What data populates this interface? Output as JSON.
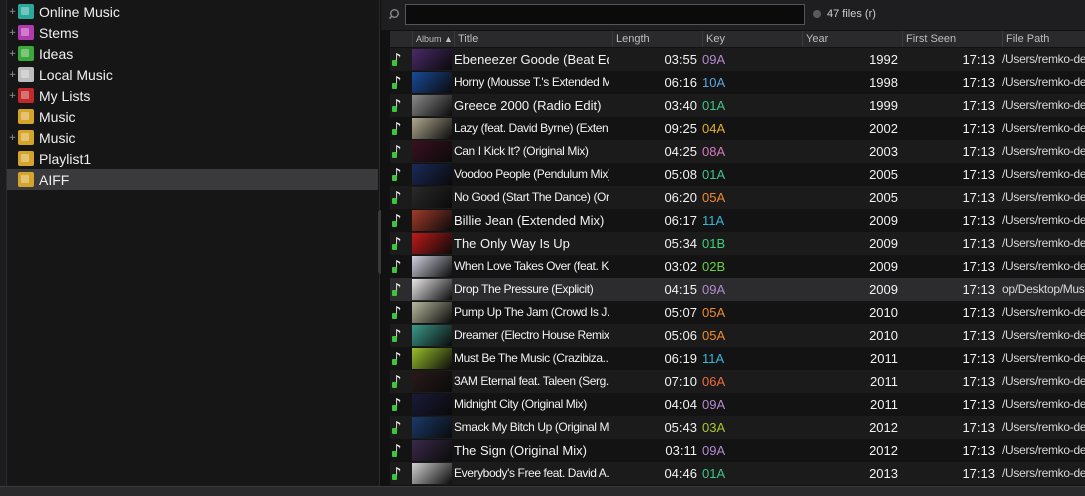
{
  "sidebar": {
    "items": [
      {
        "label": "Online Music",
        "icon": "online-music-icon",
        "color": "#2aa89a",
        "toggle": "+"
      },
      {
        "label": "Stems",
        "icon": "stems-icon",
        "color": "#b23ab0",
        "toggle": "+"
      },
      {
        "label": "Ideas",
        "icon": "ideas-icon",
        "color": "#3aa83a",
        "toggle": "+"
      },
      {
        "label": "Local Music",
        "icon": "local-music-icon",
        "color": "#bdbdbd",
        "toggle": "+"
      },
      {
        "label": "My Lists",
        "icon": "my-lists-icon",
        "color": "#c02a2a",
        "toggle": "+"
      },
      {
        "label": "Music",
        "icon": "star-folder-icon",
        "color": "#d4a52a",
        "toggle": ""
      },
      {
        "label": "Music",
        "icon": "star-folder-icon",
        "color": "#d4a52a",
        "toggle": "+"
      },
      {
        "label": "Playlist1",
        "icon": "folder-icon",
        "color": "#d4a52a",
        "toggle": ""
      },
      {
        "label": "AIFF",
        "icon": "star-folder-icon",
        "color": "#d4a52a",
        "toggle": "",
        "selected": true
      }
    ]
  },
  "folders_tab": "folders",
  "search": {
    "value": "",
    "placeholder": ""
  },
  "file_count": "47 files (r)",
  "columns": {
    "album": "Album",
    "title": "Title",
    "length": "Length",
    "key": "Key",
    "year": "Year",
    "first_seen": "First Seen",
    "file_path": "File Path"
  },
  "key_colors": {
    "09A": "#b48ad0",
    "10A": "#5aa8e0",
    "01A": "#3ec58a",
    "04A": "#e8b020",
    "08A": "#d878c0",
    "05A": "#ef8a30",
    "11A": "#36b8d8",
    "01B": "#3ed07a",
    "02B": "#6ad040",
    "06A": "#f06a40",
    "03A": "#a8c830"
  },
  "tracks": [
    {
      "title": "Ebeneezer Goode (Beat Edit)",
      "length": "03:55",
      "key": "09A",
      "year": "1992",
      "first_seen": "17:13",
      "path": "/Users/remko-desk",
      "art": "#4a2a6a"
    },
    {
      "title": "Horny (Mousse T.'s Extended Mix)",
      "length": "06:16",
      "key": "10A",
      "year": "1998",
      "first_seen": "17:13",
      "path": "/Users/remko-desk",
      "art": "#1a4a9a"
    },
    {
      "title": "Greece 2000 (Radio Edit)",
      "length": "03:40",
      "key": "01A",
      "year": "1999",
      "first_seen": "17:13",
      "path": "/Users/remko-desk",
      "art": "#8a8a8a"
    },
    {
      "title": "Lazy (feat. David Byrne) (Exten...",
      "length": "09:25",
      "key": "04A",
      "year": "2002",
      "first_seen": "17:13",
      "path": "/Users/remko-desk",
      "art": "#b0a890"
    },
    {
      "title": "Can I Kick It? (Original Mix)",
      "length": "04:25",
      "key": "08A",
      "year": "2003",
      "first_seen": "17:13",
      "path": "/Users/remko-desk",
      "art": "#3a1020"
    },
    {
      "title": "Voodoo People (Pendulum Mix)...",
      "length": "05:08",
      "key": "01A",
      "year": "2005",
      "first_seen": "17:13",
      "path": "/Users/remko-desk",
      "art": "#1a2a5a"
    },
    {
      "title": "No Good (Start The Dance) (Or...",
      "length": "06:20",
      "key": "05A",
      "year": "2005",
      "first_seen": "17:13",
      "path": "/Users/remko-desk",
      "art": "#2a2a2a"
    },
    {
      "title": "Billie Jean (Extended Mix)",
      "length": "06:17",
      "key": "11A",
      "year": "2009",
      "first_seen": "17:13",
      "path": "/Users/remko-desk",
      "art": "#a03a2a"
    },
    {
      "title": "The Only Way Is Up",
      "length": "05:34",
      "key": "01B",
      "year": "2009",
      "first_seen": "17:13",
      "path": "/Users/remko-desk",
      "art": "#c01a1a"
    },
    {
      "title": "When Love Takes Over (feat. K...",
      "length": "03:02",
      "key": "02B",
      "year": "2009",
      "first_seen": "17:13",
      "path": "/Users/remko-desk",
      "art": "#d0d0e0"
    },
    {
      "title": "Drop The Pressure (Explicit)",
      "length": "04:15",
      "key": "09A",
      "year": "2009",
      "first_seen": "17:13",
      "path": "op/Desktop/Music/",
      "art": "#e8e8e8",
      "highlight": true
    },
    {
      "title": "Pump Up The Jam (Crowd Is J...",
      "length": "05:07",
      "key": "05A",
      "year": "2010",
      "first_seen": "17:13",
      "path": "/Users/remko-desk",
      "art": "#b8b8a0"
    },
    {
      "title": "Dreamer (Electro House Remix)",
      "length": "05:06",
      "key": "05A",
      "year": "2010",
      "first_seen": "17:13",
      "path": "/Users/remko-desk",
      "art": "#3a9a8a"
    },
    {
      "title": "Must Be The Music (Crazibiza...",
      "length": "06:19",
      "key": "11A",
      "year": "2011",
      "first_seen": "17:13",
      "path": "/Users/remko-desk",
      "art": "#9ac02a"
    },
    {
      "title": "3AM Eternal feat. Taleen (Serg...",
      "length": "07:10",
      "key": "06A",
      "year": "2011",
      "first_seen": "17:13",
      "path": "/Users/remko-desk",
      "art": "#2a1a1a"
    },
    {
      "title": "Midnight City (Original Mix)",
      "length": "04:04",
      "key": "09A",
      "year": "2011",
      "first_seen": "17:13",
      "path": "/Users/remko-desk",
      "art": "#1a1a3a"
    },
    {
      "title": "Smack My Bitch Up (Original Mix)",
      "length": "05:43",
      "key": "03A",
      "year": "2012",
      "first_seen": "17:13",
      "path": "/Users/remko-desk",
      "art": "#1a3a6a"
    },
    {
      "title": "The Sign (Original Mix)",
      "length": "03:11",
      "key": "09A",
      "year": "2012",
      "first_seen": "17:13",
      "path": "/Users/remko-desk",
      "art": "#3a2a4a"
    },
    {
      "title": "Everybody's Free feat. David A...",
      "length": "04:46",
      "key": "01A",
      "year": "2013",
      "first_seen": "17:13",
      "path": "/Users/remko-desk",
      "art": "#d0d0d0"
    }
  ]
}
